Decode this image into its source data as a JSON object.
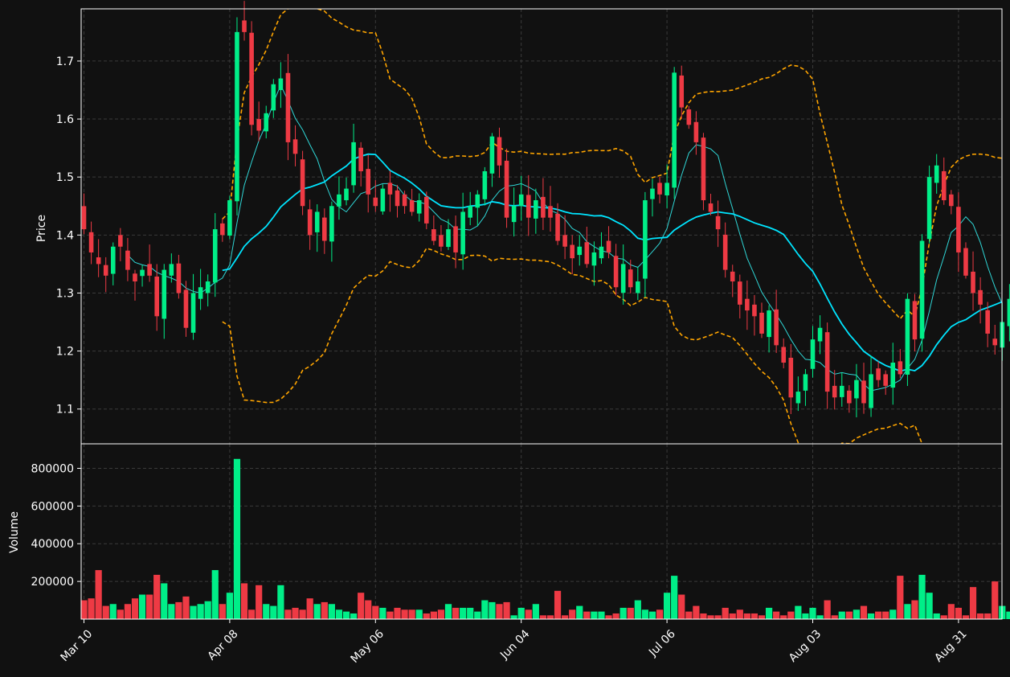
{
  "colors": {
    "background": "#111111",
    "axes_border": "#ffffff",
    "grid": "#3a3a3a",
    "up": "#00ee88",
    "down": "#ee3a44",
    "ma_slow": "#00e5ff",
    "ma_fast": "#2fd6d6",
    "bands": "#ffa500",
    "text": "#ffffff"
  },
  "chart_data": {
    "type": "candlestick",
    "price_axis": {
      "label": "Price",
      "ylim": [
        1.04,
        1.79
      ],
      "ticks": [
        "1.1",
        "1.2",
        "1.3",
        "1.4",
        "1.5",
        "1.6",
        "1.7"
      ],
      "tick_values": [
        1.1,
        1.2,
        1.3,
        1.4,
        1.5,
        1.6,
        1.7
      ]
    },
    "volume_axis": {
      "label": "Volume",
      "ylim": [
        0,
        930000
      ],
      "ticks": [
        "200000",
        "400000",
        "600000",
        "800000"
      ],
      "tick_values": [
        200000,
        400000,
        600000,
        800000
      ]
    },
    "x_axis": {
      "ticks": [
        "Mar 10",
        "Apr 08",
        "May 06",
        "Jun 04",
        "Jul 06",
        "Aug 03",
        "Aug 31"
      ],
      "tick_index": [
        0,
        20,
        40,
        60,
        80,
        100,
        120
      ]
    },
    "grid": true,
    "series": [
      {
        "type": "candles",
        "up_color": "#00ee88",
        "down_color": "#ee3a44"
      },
      {
        "type": "line",
        "role": "moving-average-fast",
        "color": "#2fd6d6"
      },
      {
        "type": "line",
        "role": "moving-average-slow",
        "color": "#00e5ff"
      },
      {
        "type": "line",
        "role": "bollinger-bands",
        "color": "#ffa500",
        "style": "dashed"
      },
      {
        "type": "bar",
        "role": "volume"
      }
    ],
    "closes": [
      1.41,
      1.37,
      1.35,
      1.33,
      1.38,
      1.38,
      1.34,
      1.32,
      1.34,
      1.33,
      1.26,
      1.34,
      1.35,
      1.3,
      1.24,
      1.3,
      1.31,
      1.32,
      1.41,
      1.4,
      1.46,
      1.75,
      1.75,
      1.59,
      1.58,
      1.61,
      1.66,
      1.67,
      1.56,
      1.54,
      1.45,
      1.4,
      1.44,
      1.39,
      1.45,
      1.47,
      1.48,
      1.56,
      1.51,
      1.47,
      1.45,
      1.48,
      1.47,
      1.45,
      1.45,
      1.44,
      1.46,
      1.42,
      1.39,
      1.38,
      1.41,
      1.37,
      1.44,
      1.45,
      1.47,
      1.51,
      1.57,
      1.52,
      1.43,
      1.45,
      1.47,
      1.43,
      1.46,
      1.43,
      1.43,
      1.39,
      1.38,
      1.36,
      1.38,
      1.35,
      1.37,
      1.38,
      1.37,
      1.31,
      1.35,
      1.31,
      1.32,
      1.46,
      1.48,
      1.47,
      1.49,
      1.68,
      1.62,
      1.59,
      1.56,
      1.46,
      1.44,
      1.41,
      1.34,
      1.32,
      1.28,
      1.27,
      1.26,
      1.23,
      1.27,
      1.21,
      1.18,
      1.12,
      1.13,
      1.16,
      1.22,
      1.24,
      1.13,
      1.12,
      1.14,
      1.11,
      1.15,
      1.11,
      1.16,
      1.15,
      1.14,
      1.18,
      1.16,
      1.29,
      1.22,
      1.39,
      1.5,
      1.52,
      1.46,
      1.45,
      1.37,
      1.33,
      1.3,
      1.28,
      1.23,
      1.21,
      1.25,
      1.29
    ],
    "volumes": [
      100000,
      110000,
      260000,
      70000,
      80000,
      50000,
      80000,
      110000,
      130000,
      130000,
      235000,
      190000,
      80000,
      90000,
      120000,
      70000,
      80000,
      95000,
      260000,
      80000,
      140000,
      850000,
      190000,
      50000,
      180000,
      80000,
      70000,
      180000,
      50000,
      60000,
      50000,
      110000,
      80000,
      90000,
      80000,
      50000,
      40000,
      30000,
      140000,
      100000,
      70000,
      60000,
      40000,
      60000,
      50000,
      50000,
      50000,
      30000,
      40000,
      50000,
      80000,
      60000,
      60000,
      60000,
      40000,
      100000,
      90000,
      80000,
      90000,
      20000,
      60000,
      50000,
      80000,
      20000,
      20000,
      150000,
      20000,
      50000,
      70000,
      40000,
      40000,
      40000,
      20000,
      30000,
      60000,
      60000,
      100000,
      50000,
      40000,
      50000,
      140000,
      230000,
      130000,
      40000,
      70000,
      30000,
      20000,
      20000,
      60000,
      30000,
      50000,
      30000,
      30000,
      20000,
      60000,
      40000,
      20000,
      40000,
      70000,
      30000,
      60000,
      20000,
      100000,
      20000,
      40000,
      40000,
      50000,
      70000,
      30000,
      40000,
      40000,
      50000,
      230000,
      80000,
      100000,
      235000,
      140000,
      30000,
      20000,
      80000,
      60000,
      20000,
      170000,
      30000,
      30000,
      200000,
      70000,
      40000
    ]
  }
}
